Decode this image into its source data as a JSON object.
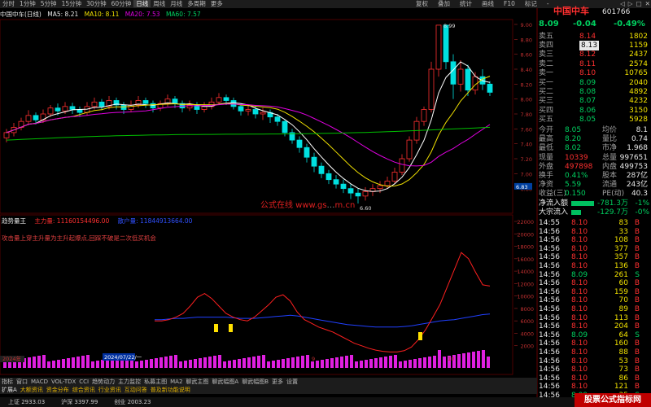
{
  "toolbar": {
    "periods": [
      "分时",
      "1分钟",
      "5分钟",
      "15分钟",
      "30分钟",
      "60分钟",
      "日线",
      "周线",
      "月线",
      "多周期",
      "更多"
    ],
    "selected": "日线",
    "right_tabs": [
      "复权",
      "叠加",
      "统计",
      "画线",
      "F10",
      "标记",
      "-"
    ],
    "window_controls": [
      "◁",
      "▷",
      "□",
      "✕"
    ]
  },
  "ma_line": {
    "stock": "中国中车(日线)",
    "ma5": "MA5: 8.21",
    "ma10": "MA10: 8.11",
    "ma20": "MA20: 7.53",
    "ma60": "MA60: 7.57",
    "colors": {
      "ma5": "#ffffff",
      "ma10": "#f0e000",
      "ma20": "#e000e0",
      "ma60": "#00c000"
    }
  },
  "quote": {
    "title_logo": "中国中车",
    "code": "601766",
    "price": "8.09",
    "change": "-0.04",
    "pct": "-0.49%",
    "asks": [
      {
        "label": "卖五",
        "price": "8.14",
        "vol": "1802"
      },
      {
        "label": "卖四",
        "price": "8.13",
        "vol": "1159"
      },
      {
        "label": "卖三",
        "price": "8.12",
        "vol": "2437"
      },
      {
        "label": "卖二",
        "price": "8.11",
        "vol": "2574"
      },
      {
        "label": "卖一",
        "price": "8.10",
        "vol": "10765"
      }
    ],
    "bids": [
      {
        "label": "买一",
        "price": "8.09",
        "vol": "2040"
      },
      {
        "label": "买二",
        "price": "8.08",
        "vol": "4892"
      },
      {
        "label": "买三",
        "price": "8.07",
        "vol": "4232"
      },
      {
        "label": "买四",
        "price": "8.06",
        "vol": "3150"
      },
      {
        "label": "买五",
        "price": "8.05",
        "vol": "5928"
      }
    ],
    "stats": [
      {
        "l1": "今开",
        "v1": "8.05",
        "l2": "均价",
        "v2": "8.1"
      },
      {
        "l1": "最高",
        "v1": "8.20",
        "l2": "量比",
        "v2": "0.74"
      },
      {
        "l1": "最低",
        "v1": "8.02",
        "l2": "市净",
        "v2": "1.968"
      },
      {
        "l1": "现量",
        "v1": "10339",
        "l2": "总量",
        "v2": "997651"
      },
      {
        "l1": "外盘",
        "v1": "497898",
        "l2": "内盘",
        "v2": "499753"
      },
      {
        "l1": "换手",
        "v1": "0.41%",
        "l2": "股本",
        "v2": "287亿"
      },
      {
        "l1": "净资",
        "v1": "5.59",
        "l2": "流通",
        "v2": "243亿"
      },
      {
        "l1": "收益(三)",
        "v1": "0.150",
        "l2": "PE(动)",
        "v2": "40.3"
      }
    ],
    "flows": [
      {
        "label": "净流入额",
        "value": "-781.3万",
        "tag": "-1%"
      },
      {
        "label": "大宗流入",
        "value": "-129.7万",
        "tag": "-0%"
      }
    ]
  },
  "ticks": [
    {
      "t": "14:55",
      "p": "8.10",
      "v": "83",
      "s": "B"
    },
    {
      "t": "14:56",
      "p": "8.10",
      "v": "33",
      "s": "B"
    },
    {
      "t": "14:56",
      "p": "8.10",
      "v": "108",
      "s": "B"
    },
    {
      "t": "14:56",
      "p": "8.10",
      "v": "377",
      "s": "B"
    },
    {
      "t": "14:56",
      "p": "8.10",
      "v": "357",
      "s": "B"
    },
    {
      "t": "14:56",
      "p": "8.10",
      "v": "136",
      "s": "B"
    },
    {
      "t": "14:56",
      "p": "8.09",
      "v": "261",
      "s": "S"
    },
    {
      "t": "14:56",
      "p": "8.10",
      "v": "60",
      "s": "B"
    },
    {
      "t": "14:56",
      "p": "8.10",
      "v": "159",
      "s": "B"
    },
    {
      "t": "14:56",
      "p": "8.10",
      "v": "70",
      "s": "B"
    },
    {
      "t": "14:56",
      "p": "8.10",
      "v": "89",
      "s": "B"
    },
    {
      "t": "14:56",
      "p": "8.10",
      "v": "113",
      "s": "B"
    },
    {
      "t": "14:56",
      "p": "8.10",
      "v": "204",
      "s": "B"
    },
    {
      "t": "14:56",
      "p": "8.09",
      "v": "64",
      "s": "S"
    },
    {
      "t": "14:56",
      "p": "8.10",
      "v": "160",
      "s": "B"
    },
    {
      "t": "14:56",
      "p": "8.10",
      "v": "88",
      "s": "B"
    },
    {
      "t": "14:56",
      "p": "8.10",
      "v": "53",
      "s": "B"
    },
    {
      "t": "14:56",
      "p": "8.10",
      "v": "73",
      "s": "B"
    },
    {
      "t": "14:56",
      "p": "8.10",
      "v": "86",
      "s": "B"
    },
    {
      "t": "14:56",
      "p": "8.10",
      "v": "121",
      "s": "B"
    },
    {
      "t": "14:56",
      "p": "8.09",
      "v": "35",
      "s": "S"
    },
    {
      "t": "15:00",
      "p": "8.09",
      "v": "10339",
      "s": "B"
    }
  ],
  "price_axis": [
    "9.00",
    "8.80",
    "8.60",
    "8.40",
    "8.20",
    "8.00",
    "7.80",
    "7.60",
    "7.40",
    "7.20",
    "7.00",
    "6.80"
  ],
  "price_marker": "6.83",
  "indicator": {
    "name": "趋势量王",
    "v1": "主力量: 11160154496.00",
    "v2": "散户量: 11844913664.00",
    "note": "攻击量上穿主升量为主升起爆点,回踩不破是二次低买机会",
    "axis": [
      "22000",
      "20000",
      "18000",
      "16000",
      "14000",
      "12000",
      "10000",
      "8000",
      "6000",
      "4000",
      "2000"
    ]
  },
  "annotations": {
    "high_label": "8.99",
    "low_label": "6.60",
    "watermark": "公式在线 www.gs",
    "watermark_tail": "m.cn",
    "date_left": "2024年",
    "date_mid": "2024/07/22/一",
    "month_9": "9",
    "month_10": "10"
  },
  "bottom_tabs_1": [
    "指标",
    "窗口",
    "MACD",
    "VOL-TDX",
    "CCI",
    "趋势动力",
    "主力监控",
    "私募主图",
    "MA2",
    "聊武主图",
    "聊武幅图A",
    "聊武幅图B",
    "更多",
    "设置"
  ],
  "bottom_tabs_2": [
    "扩展A",
    "大额资讯",
    "资金分布",
    "综合资讯",
    "行业资讯",
    "互动问答",
    "普及新功能说明"
  ],
  "status": [
    "上证 2933.03",
    "沪深 3397.99",
    "创业 2003.23"
  ],
  "watermark_br": "股票公式指标网",
  "chart_data": {
    "type": "candlestick",
    "candles": [
      {
        "o": 7.48,
        "c": 7.55,
        "h": 7.6,
        "l": 7.42
      },
      {
        "o": 7.55,
        "c": 7.62,
        "h": 7.68,
        "l": 7.5
      },
      {
        "o": 7.62,
        "c": 7.7,
        "h": 7.75,
        "l": 7.58
      },
      {
        "o": 7.7,
        "c": 7.78,
        "h": 7.85,
        "l": 7.65
      },
      {
        "o": 7.78,
        "c": 7.72,
        "h": 7.82,
        "l": 7.66
      },
      {
        "o": 7.72,
        "c": 7.8,
        "h": 7.86,
        "l": 7.68
      },
      {
        "o": 7.8,
        "c": 7.88,
        "h": 7.92,
        "l": 7.76
      },
      {
        "o": 7.88,
        "c": 7.84,
        "h": 7.94,
        "l": 7.78
      },
      {
        "o": 7.84,
        "c": 7.9,
        "h": 7.96,
        "l": 7.8
      },
      {
        "o": 7.9,
        "c": 7.86,
        "h": 7.95,
        "l": 7.8
      },
      {
        "o": 7.86,
        "c": 7.82,
        "h": 7.9,
        "l": 7.76
      },
      {
        "o": 7.82,
        "c": 7.9,
        "h": 7.96,
        "l": 7.78
      },
      {
        "o": 7.9,
        "c": 7.96,
        "h": 8.02,
        "l": 7.86
      },
      {
        "o": 7.96,
        "c": 7.9,
        "h": 8.0,
        "l": 7.85
      },
      {
        "o": 7.9,
        "c": 7.98,
        "h": 8.04,
        "l": 7.86
      },
      {
        "o": 7.98,
        "c": 7.92,
        "h": 8.02,
        "l": 7.86
      },
      {
        "o": 7.92,
        "c": 7.86,
        "h": 7.96,
        "l": 7.8
      },
      {
        "o": 7.86,
        "c": 7.92,
        "h": 7.98,
        "l": 7.82
      },
      {
        "o": 7.92,
        "c": 7.98,
        "h": 8.04,
        "l": 7.88
      },
      {
        "o": 7.98,
        "c": 7.94,
        "h": 8.02,
        "l": 7.88
      },
      {
        "o": 7.94,
        "c": 7.88,
        "h": 7.98,
        "l": 7.82
      },
      {
        "o": 7.88,
        "c": 7.94,
        "h": 7.98,
        "l": 7.84
      },
      {
        "o": 7.94,
        "c": 8.0,
        "h": 8.06,
        "l": 7.9
      },
      {
        "o": 8.0,
        "c": 7.94,
        "h": 8.04,
        "l": 7.88
      },
      {
        "o": 7.94,
        "c": 7.88,
        "h": 7.98,
        "l": 7.82
      },
      {
        "o": 7.88,
        "c": 7.92,
        "h": 7.98,
        "l": 7.84
      },
      {
        "o": 7.92,
        "c": 7.86,
        "h": 7.96,
        "l": 7.8
      },
      {
        "o": 7.86,
        "c": 7.9,
        "h": 7.96,
        "l": 7.82
      },
      {
        "o": 7.9,
        "c": 7.96,
        "h": 8.02,
        "l": 7.86
      },
      {
        "o": 7.96,
        "c": 8.02,
        "h": 8.08,
        "l": 7.92
      },
      {
        "o": 8.02,
        "c": 7.98,
        "h": 8.06,
        "l": 7.92
      },
      {
        "o": 7.98,
        "c": 7.9,
        "h": 8.02,
        "l": 7.86
      },
      {
        "o": 7.9,
        "c": 7.84,
        "h": 7.94,
        "l": 7.78
      },
      {
        "o": 7.84,
        "c": 7.86,
        "h": 7.92,
        "l": 7.78
      },
      {
        "o": 7.86,
        "c": 7.8,
        "h": 7.9,
        "l": 7.74
      },
      {
        "o": 7.8,
        "c": 7.82,
        "h": 7.88,
        "l": 7.72
      },
      {
        "o": 7.82,
        "c": 7.76,
        "h": 7.86,
        "l": 7.68
      },
      {
        "o": 7.76,
        "c": 7.7,
        "h": 7.8,
        "l": 7.64
      },
      {
        "o": 7.7,
        "c": 7.55,
        "h": 7.72,
        "l": 7.5
      },
      {
        "o": 7.55,
        "c": 7.45,
        "h": 7.6,
        "l": 7.4
      },
      {
        "o": 7.45,
        "c": 7.35,
        "h": 7.5,
        "l": 7.28
      },
      {
        "o": 7.35,
        "c": 7.22,
        "h": 7.4,
        "l": 7.15
      },
      {
        "o": 7.22,
        "c": 7.1,
        "h": 7.28,
        "l": 7.02
      },
      {
        "o": 7.1,
        "c": 7.0,
        "h": 7.15,
        "l": 6.94
      },
      {
        "o": 7.0,
        "c": 6.92,
        "h": 7.05,
        "l": 6.86
      },
      {
        "o": 6.92,
        "c": 6.86,
        "h": 6.98,
        "l": 6.8
      },
      {
        "o": 6.86,
        "c": 6.8,
        "h": 6.92,
        "l": 6.74
      },
      {
        "o": 6.8,
        "c": 6.74,
        "h": 6.86,
        "l": 6.66
      },
      {
        "o": 6.74,
        "c": 6.7,
        "h": 6.8,
        "l": 6.6
      },
      {
        "o": 6.7,
        "c": 6.76,
        "h": 6.82,
        "l": 6.64
      },
      {
        "o": 6.76,
        "c": 6.8,
        "h": 6.86,
        "l": 6.7
      },
      {
        "o": 6.8,
        "c": 6.84,
        "h": 6.9,
        "l": 6.74
      },
      {
        "o": 6.84,
        "c": 6.9,
        "h": 6.96,
        "l": 6.8
      },
      {
        "o": 6.9,
        "c": 7.02,
        "h": 7.08,
        "l": 6.86
      },
      {
        "o": 7.02,
        "c": 7.2,
        "h": 7.26,
        "l": 6.98
      },
      {
        "o": 7.2,
        "c": 7.45,
        "h": 7.5,
        "l": 7.16
      },
      {
        "o": 7.45,
        "c": 7.7,
        "h": 7.76,
        "l": 7.4
      },
      {
        "o": 7.7,
        "c": 7.86,
        "h": 7.9,
        "l": 7.64
      },
      {
        "o": 7.86,
        "c": 8.4,
        "h": 8.5,
        "l": 7.82
      },
      {
        "o": 8.4,
        "c": 8.99,
        "h": 8.99,
        "l": 8.3
      },
      {
        "o": 8.99,
        "c": 8.5,
        "h": 8.99,
        "l": 8.4
      },
      {
        "o": 8.5,
        "c": 8.2,
        "h": 8.6,
        "l": 8.0
      },
      {
        "o": 8.2,
        "c": 8.4,
        "h": 8.52,
        "l": 8.1
      },
      {
        "o": 8.4,
        "c": 8.12,
        "h": 8.46,
        "l": 8.04
      },
      {
        "o": 8.12,
        "c": 8.3,
        "h": 8.36,
        "l": 8.06
      },
      {
        "o": 8.3,
        "c": 8.2,
        "h": 8.4,
        "l": 8.12
      },
      {
        "o": 8.2,
        "c": 8.09,
        "h": 8.24,
        "l": 8.04
      }
    ],
    "indicator_red": [
      6000,
      6000,
      6200,
      6600,
      7200,
      8400,
      9800,
      10400,
      9600,
      8400,
      7200,
      6600,
      6200,
      6000,
      6600,
      7600,
      8600,
      9800,
      10200,
      9200,
      7400,
      6200,
      5600,
      5000,
      4600,
      4200,
      3600,
      3000,
      2400,
      2000,
      1600,
      1300,
      1100,
      1000,
      1000,
      1200,
      1800,
      3000,
      4600,
      6600,
      8600,
      11400,
      14200,
      17000,
      16000,
      13800,
      11800,
      11600
    ],
    "indicator_blue": [
      6200,
      6200,
      6300,
      6400,
      6400,
      6500,
      6600,
      6600,
      6600,
      6600,
      6600,
      6500,
      6400,
      6400,
      6400,
      6500,
      6600,
      6700,
      6800,
      6900,
      6800,
      6600,
      6400,
      6200,
      6000,
      5800,
      5600,
      5400,
      5300,
      5200,
      5100,
      5000,
      5000,
      5000,
      5000,
      5100,
      5200,
      5400,
      5600,
      5800,
      6000,
      6100,
      6200,
      6400,
      6600,
      6800,
      7000,
      7100
    ]
  }
}
